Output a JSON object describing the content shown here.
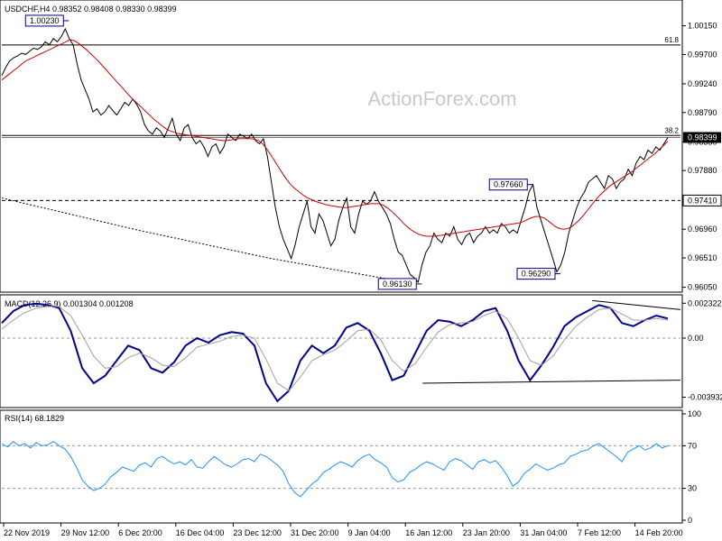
{
  "chart_data": [
    {
      "type": "line",
      "panel": "price",
      "symbol_line": "USDCHF,H4  0.98352 0.98408 0.98330 0.98399",
      "watermark": "ActionForex.com",
      "ylim": [
        0.9603,
        1.003
      ],
      "y_ticks": [
        1.0015,
        0.997,
        0.9924,
        0.9879,
        0.9833,
        0.9788,
        0.9741,
        0.9696,
        0.9651,
        0.9605
      ],
      "y_tick_labels": [
        "1.00150",
        "0.99700",
        "0.99240",
        "0.98790",
        "0.98330",
        "0.97880",
        "0.97410",
        "0.96960",
        "0.96510",
        "0.96050"
      ],
      "current_price_label": "0.98399",
      "support_label": "0.97410",
      "fib_levels": [
        {
          "label": "61.8",
          "value": 0.9985
        },
        {
          "label": "38.2",
          "value": 0.9843
        }
      ],
      "support_line": 0.9741,
      "current_price": 0.98399,
      "annotations": [
        {
          "label": "1.00230",
          "bar": 16,
          "value": 1.0023
        },
        {
          "label": "0.96130",
          "bar": 105,
          "value": 0.9613
        },
        {
          "label": "0.97660",
          "bar": 133,
          "value": 0.9766
        },
        {
          "label": "0.96290",
          "bar": 140,
          "value": 0.9629
        }
      ],
      "series": [
        {
          "role": "price",
          "color": "#000000",
          "values": [
            0.9937,
            0.995,
            0.996,
            0.9965,
            0.9968,
            0.9972,
            0.997,
            0.9975,
            0.998,
            0.9978,
            0.9982,
            0.999,
            0.9985,
            0.9995,
            0.999,
            0.9998,
            1.001,
            0.9995,
            0.9985,
            0.9955,
            0.993,
            0.9915,
            0.99,
            0.988,
            0.9885,
            0.9875,
            0.988,
            0.989,
            0.9882,
            0.9875,
            0.9885,
            0.9895,
            0.989,
            0.99,
            0.9892,
            0.988,
            0.986,
            0.985,
            0.9845,
            0.9855,
            0.985,
            0.984,
            0.9855,
            0.987,
            0.9845,
            0.9835,
            0.9855,
            0.986,
            0.984,
            0.983,
            0.9835,
            0.9825,
            0.981,
            0.9825,
            0.983,
            0.9815,
            0.9825,
            0.9845,
            0.984,
            0.9835,
            0.9845,
            0.9842,
            0.9838,
            0.9845,
            0.9835,
            0.983,
            0.9838,
            0.981,
            0.977,
            0.973,
            0.97,
            0.968,
            0.9665,
            0.965,
            0.9672,
            0.97,
            0.972,
            0.974,
            0.97,
            0.969,
            0.972,
            0.971,
            0.969,
            0.967,
            0.968,
            0.971,
            0.973,
            0.9745,
            0.97,
            0.969,
            0.972,
            0.974,
            0.9735,
            0.974,
            0.9755,
            0.974,
            0.973,
            0.972,
            0.9705,
            0.968,
            0.966,
            0.9655,
            0.964,
            0.9625,
            0.962,
            0.9613,
            0.964,
            0.966,
            0.967,
            0.969,
            0.968,
            0.9675,
            0.969,
            0.9685,
            0.97,
            0.968,
            0.9672,
            0.9685,
            0.969,
            0.9675,
            0.9685,
            0.969,
            0.97,
            0.969,
            0.9695,
            0.969,
            0.9705,
            0.97,
            0.969,
            0.9695,
            0.969,
            0.971,
            0.973,
            0.9755,
            0.9766,
            0.973,
            0.971,
            0.969,
            0.967,
            0.965,
            0.9629,
            0.964,
            0.966,
            0.969,
            0.971,
            0.973,
            0.9745,
            0.9755,
            0.977,
            0.9775,
            0.978,
            0.977,
            0.976,
            0.978,
            0.9775,
            0.976,
            0.977,
            0.9775,
            0.979,
            0.978,
            0.98,
            0.981,
            0.9805,
            0.982,
            0.9815,
            0.9825,
            0.982,
            0.983,
            0.984
          ]
        },
        {
          "role": "moving_average",
          "color": "#cc0000",
          "values": [
            0.993,
            0.9935,
            0.994,
            0.9945,
            0.995,
            0.9955,
            0.996,
            0.9963,
            0.9966,
            0.9969,
            0.9972,
            0.9975,
            0.9978,
            0.9981,
            0.9984,
            0.9987,
            0.999,
            0.9993,
            0.9992,
            0.9988,
            0.9983,
            0.9978,
            0.9972,
            0.9966,
            0.996,
            0.9953,
            0.9946,
            0.9939,
            0.9932,
            0.9925,
            0.9918,
            0.9911,
            0.9904,
            0.9898,
            0.9892,
            0.9886,
            0.988,
            0.9874,
            0.9868,
            0.9863,
            0.9858,
            0.9853,
            0.985,
            0.9848,
            0.9846,
            0.9845,
            0.9844,
            0.9843,
            0.9842,
            0.9841,
            0.984,
            0.9839,
            0.9838,
            0.9837,
            0.9836,
            0.9835,
            0.9835,
            0.9836,
            0.9837,
            0.9838,
            0.9838,
            0.9838,
            0.9838,
            0.9837,
            0.9835,
            0.983,
            0.9822,
            0.9813,
            0.9803,
            0.9793,
            0.9783,
            0.9774,
            0.9766,
            0.976,
            0.9755,
            0.975,
            0.9746,
            0.9743,
            0.974,
            0.9738,
            0.9736,
            0.9734,
            0.9733,
            0.9732,
            0.9731,
            0.973,
            0.973,
            0.9731,
            0.9732,
            0.9733,
            0.9734,
            0.9735,
            0.9736,
            0.9736,
            0.9736,
            0.9734,
            0.973,
            0.9725,
            0.9719,
            0.9713,
            0.9706,
            0.97,
            0.9695,
            0.9691,
            0.9688,
            0.9686,
            0.9685,
            0.9685,
            0.9685,
            0.9686,
            0.9687,
            0.9688,
            0.9689,
            0.969,
            0.9691,
            0.9692,
            0.9693,
            0.9694,
            0.9695,
            0.9696,
            0.9697,
            0.9698,
            0.9699,
            0.97,
            0.9701,
            0.9702,
            0.9703,
            0.9704,
            0.9705,
            0.9706,
            0.9708,
            0.9711,
            0.9714,
            0.9716,
            0.9716,
            0.9714,
            0.971,
            0.9705,
            0.97,
            0.9697,
            0.9696,
            0.9697,
            0.97,
            0.9705,
            0.9711,
            0.9718,
            0.9726,
            0.9734,
            0.9742,
            0.9749,
            0.9755,
            0.9761,
            0.9766,
            0.977,
            0.9774,
            0.9778,
            0.9782,
            0.9786,
            0.9791,
            0.9796,
            0.9801,
            0.9806,
            0.9811,
            0.9816,
            0.9822,
            0.9828,
            0.9834
          ]
        },
        {
          "role": "long_moving_average",
          "color": "#000000",
          "dashed": true,
          "values": [
            0.9745,
            0.9695,
            0.965,
            0.9613
          ]
        }
      ]
    },
    {
      "type": "line",
      "panel": "macd",
      "title": "MACD(12,26,9) 0.001304 0.001208",
      "ylim": [
        -0.0045,
        0.0027
      ],
      "y_ticks": [
        0.002322,
        0.0,
        -0.003932
      ],
      "y_tick_labels": [
        "0.002322",
        "0.00",
        "-0.003932"
      ],
      "zero_line": 0.0,
      "series": [
        {
          "role": "macd",
          "color": "#00008b",
          "values": [
            0.001,
            0.0018,
            0.0022,
            0.0023,
            0.0022,
            0.002,
            0.0005,
            -0.002,
            -0.003,
            -0.0025,
            -0.0015,
            -0.0005,
            -0.0008,
            -0.002,
            -0.0023,
            -0.0016,
            -0.0005,
            0.0,
            -0.0003,
            0.0002,
            0.0004,
            0.0003,
            -0.0005,
            -0.003,
            -0.0042,
            -0.0035,
            -0.0015,
            -0.0005,
            -0.001,
            -0.0005,
            0.0007,
            0.001,
            0.0005,
            -0.001,
            -0.0028,
            -0.0025,
            -0.001,
            0.0005,
            0.0012,
            0.0011,
            0.0008,
            0.0012,
            0.0018,
            0.002,
            0.0005,
            -0.0015,
            -0.0028,
            -0.0018,
            -0.0006,
            0.0008,
            0.0014,
            0.0018,
            0.0022,
            0.002,
            0.001,
            0.0008,
            0.0012,
            0.0015,
            0.0013
          ]
        },
        {
          "role": "signal",
          "color": "#a0a0a0",
          "values": [
            0.0006,
            0.0012,
            0.0017,
            0.002,
            0.0021,
            0.0021,
            0.0015,
            0.0002,
            -0.0012,
            -0.002,
            -0.0019,
            -0.0013,
            -0.001,
            -0.0013,
            -0.0018,
            -0.0019,
            -0.0013,
            -0.0006,
            -0.0004,
            -0.0002,
            0.0001,
            0.0002,
            0.0,
            -0.0014,
            -0.003,
            -0.0035,
            -0.0026,
            -0.0015,
            -0.0011,
            -0.0008,
            -0.0002,
            0.0005,
            0.0006,
            -0.0001,
            -0.0015,
            -0.0022,
            -0.0017,
            -0.0006,
            0.0004,
            0.0009,
            0.001,
            0.0011,
            0.0015,
            0.0018,
            0.0013,
            0.0,
            -0.0015,
            -0.0018,
            -0.0012,
            -0.0001,
            0.0008,
            0.0014,
            0.0019,
            0.002,
            0.0016,
            0.0012,
            0.0012,
            0.0013,
            0.0012
          ]
        }
      ],
      "trendlines": [
        {
          "from": [
            0.62,
            -0.003
          ],
          "to": [
            1.0,
            -0.0028
          ]
        },
        {
          "from": [
            0.87,
            0.0025
          ],
          "to": [
            1.0,
            0.0019
          ]
        }
      ]
    },
    {
      "type": "line",
      "panel": "rsi",
      "title": "RSI(14) 68.1829",
      "ylim": [
        0,
        100
      ],
      "y_ticks": [
        100,
        70,
        30,
        0
      ],
      "y_tick_labels": [
        "100",
        "70",
        "30",
        "0"
      ],
      "levels": [
        70,
        30
      ],
      "series": [
        {
          "role": "rsi",
          "color": "#1e90ff",
          "values": [
            72,
            69,
            74,
            70,
            72,
            68,
            73,
            70,
            71,
            74,
            70,
            67,
            60,
            50,
            38,
            32,
            28,
            30,
            34,
            41,
            45,
            50,
            48,
            46,
            52,
            54,
            50,
            58,
            60,
            56,
            53,
            55,
            52,
            57,
            50,
            49,
            55,
            60,
            56,
            52,
            50,
            53,
            57,
            58,
            55,
            62,
            60,
            56,
            52,
            46,
            34,
            26,
            22,
            28,
            34,
            38,
            45,
            48,
            52,
            55,
            53,
            50,
            56,
            60,
            62,
            57,
            54,
            50,
            40,
            36,
            38,
            45,
            48,
            52,
            55,
            53,
            50,
            47,
            55,
            58,
            56,
            52,
            48,
            55,
            57,
            54,
            56,
            50,
            42,
            32,
            36,
            44,
            48,
            53,
            50,
            47,
            49,
            52,
            54,
            60,
            62,
            65,
            66,
            70,
            72,
            68,
            64,
            60,
            55,
            64,
            67,
            70,
            66,
            68,
            72,
            68,
            70
          ]
        }
      ]
    }
  ],
  "x_axis": {
    "tick_labels": [
      "22 Nov 2019",
      "29 Nov 12:00",
      "6 Dec 20:00",
      "16 Dec 04:00",
      "23 Dec 12:00",
      "31 Dec 20:00",
      "9 Jan 04:00",
      "16 Jan 12:00",
      "23 Jan 20:00",
      "31 Jan 04:00",
      "7 Feb 12:00",
      "14 Feb 20:00"
    ]
  }
}
